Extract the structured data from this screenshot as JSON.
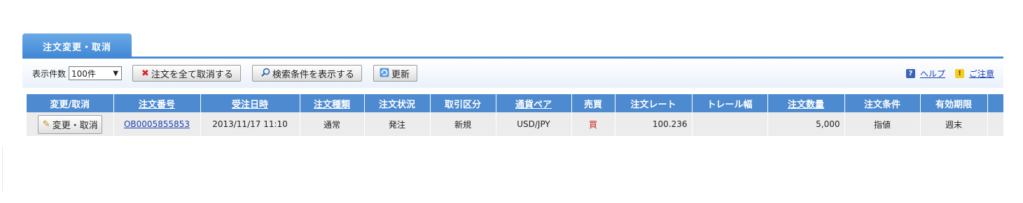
{
  "tab": {
    "label": "注文変更・取消"
  },
  "toolbar": {
    "count_label": "表示件数",
    "count_value": "100件",
    "cancel_all_label": "注文を全て取消する",
    "search_label": "検索条件を表示する",
    "refresh_label": "更新",
    "help_label": "ヘルプ",
    "caution_label": "ご注意"
  },
  "table": {
    "headers": [
      "変更/取消",
      "注文番号",
      "受注日時",
      "注文種類",
      "注文状況",
      "取引区分",
      "通貨ペア",
      "売買",
      "注文レート",
      "トレール幅",
      "注文数量",
      "注文条件",
      "有効期限",
      ""
    ],
    "rows": [
      {
        "action_label": "変更・取消",
        "order_no": "OB0005855853",
        "received_at": "2013/11/17 11:10",
        "order_type": "通常",
        "status": "発注",
        "trade_class": "新規",
        "pair": "USD/JPY",
        "side": "買",
        "rate": "100.236",
        "trail": "",
        "quantity": "5,000",
        "condition": "指値",
        "expiry": "週末",
        "extra": ""
      }
    ]
  },
  "colors": {
    "accent": "#4d8ad0",
    "tab": "#3f86d4",
    "row_bg": "#ececec",
    "buy": "#cc2222",
    "link": "#1a3fb0"
  },
  "icons": {
    "cancel_all": "x-mark-icon",
    "search": "magnifier-icon",
    "refresh": "refresh-icon",
    "help": "help-icon",
    "caution": "warning-icon",
    "edit": "pencil-icon"
  }
}
